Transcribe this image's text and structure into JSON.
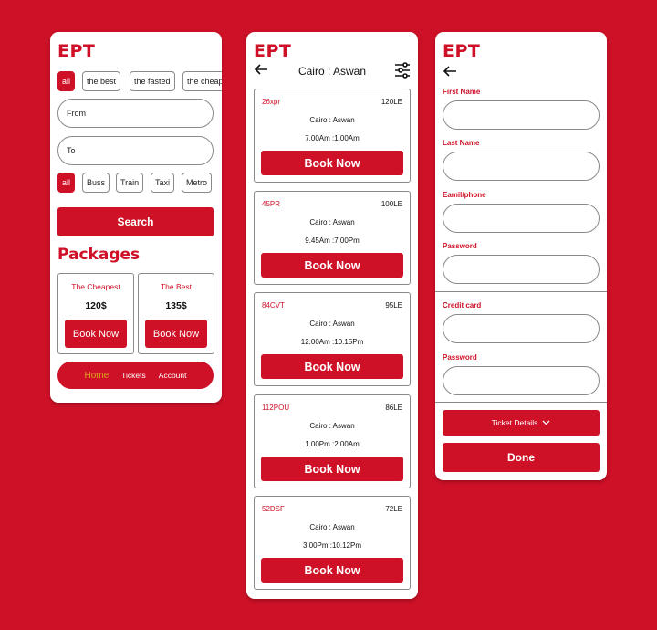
{
  "brand": "EPT",
  "search_screen": {
    "sort_chips": [
      "all",
      "the best",
      "the fasted",
      "the cheap"
    ],
    "from_placeholder": "From",
    "to_placeholder": "To",
    "transport_chips": [
      "all",
      "Buss",
      "Train",
      "Taxi",
      "Metro"
    ],
    "search_label": "Search",
    "packages_title": "Packages",
    "packages": [
      {
        "title": "The Cheapest",
        "price": "120$",
        "button": "Book Now"
      },
      {
        "title": "The Best",
        "price": "135$",
        "button": "Book Now"
      }
    ],
    "nav": [
      {
        "label": "Home",
        "active": true
      },
      {
        "label": "Tickets",
        "active": false
      },
      {
        "label": "Account",
        "active": false
      }
    ]
  },
  "trips_screen": {
    "title": "Cairo : Aswan",
    "trips": [
      {
        "code": "26xpr",
        "price": "120LE",
        "route": "Cairo : Aswan",
        "time": "7.00Am :1.00Am",
        "button": "Book Now"
      },
      {
        "code": "45PR",
        "price": "100LE",
        "route": "Cairo : Aswan",
        "time": "9.45Am :7.00Pm",
        "button": "Book Now"
      },
      {
        "code": "84CVT",
        "price": "95LE",
        "route": "Cairo : Aswan",
        "time": "12.00Am :10.15Pm",
        "button": "Book Now"
      },
      {
        "code": "112POU",
        "price": "86LE",
        "route": "Cairo : Aswan",
        "time": "1.00Pm :2.00Am",
        "button": "Book Now"
      },
      {
        "code": "52DSF",
        "price": "72LE",
        "route": "Cairo : Aswan",
        "time": "3.00Pm :10.12Pm",
        "button": "Book Now"
      }
    ]
  },
  "booking_screen": {
    "fields": [
      {
        "label": "First Name",
        "value": ""
      },
      {
        "label": "Last Name",
        "value": ""
      },
      {
        "label": "Eamil/phone",
        "value": ""
      },
      {
        "label": "Password",
        "value": ""
      },
      {
        "label": "Credit card",
        "value": ""
      },
      {
        "label": "Password",
        "value": ""
      }
    ],
    "ticket_details_label": "Ticket Details",
    "done_label": "Done"
  },
  "colors": {
    "brand_red": "#cf1127",
    "active_nav": "#d8a51c"
  }
}
